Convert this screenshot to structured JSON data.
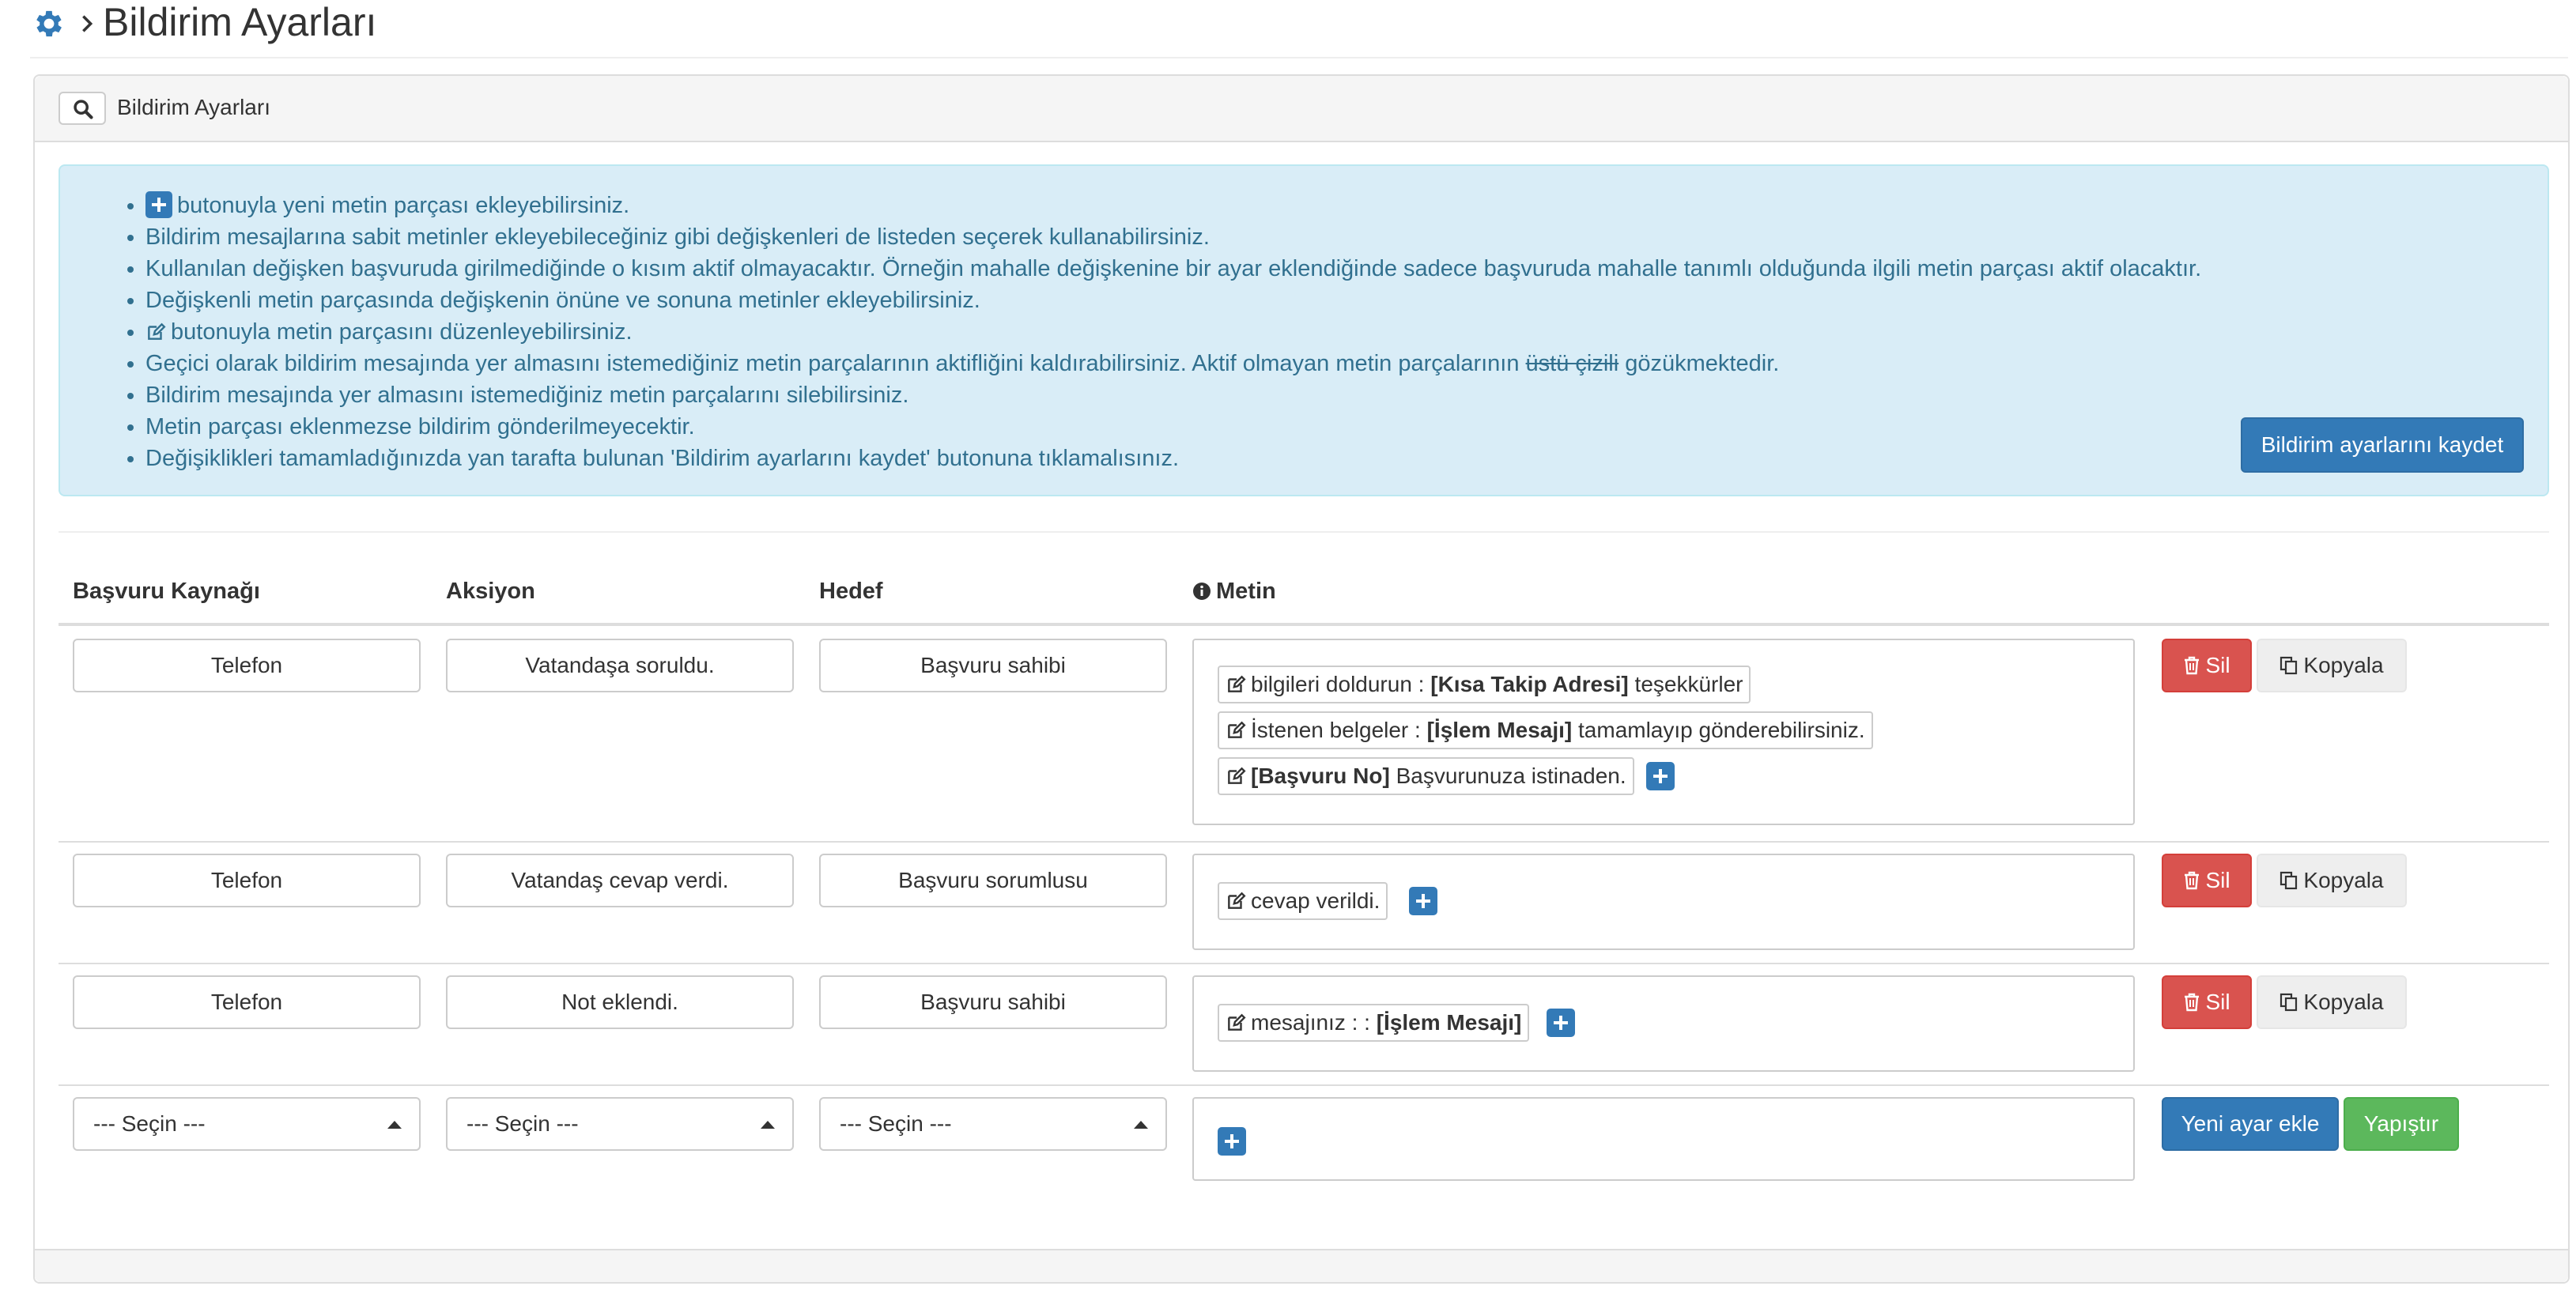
{
  "header": {
    "title": "Bildirim Ayarları"
  },
  "panel": {
    "title": "Bildirim Ayarları"
  },
  "info": {
    "items": [
      "butonuyla yeni metin parçası ekleyebilirsiniz.",
      "Bildirim mesajlarına sabit metinler ekleyebileceğiniz gibi değişkenleri de listeden seçerek kullanabilirsiniz.",
      "Kullanılan değişken başvuruda girilmediğinde o kısım aktif olmayacaktır. Örneğin mahalle değişkenine bir ayar eklendiğinde sadece başvuruda mahalle tanımlı olduğunda ilgili metin parçası aktif olacaktır.",
      "Değişkenli metin parçasında değişkenin önüne ve sonuna metinler ekleyebilirsiniz.",
      "butonuyla metin parçasını düzenleyebilirsiniz.",
      "Geçici olarak bildirim mesajında yer almasını istemediğiniz metin parçalarının aktifliğini kaldırabilirsiniz. Aktif olmayan metin parçalarının",
      "Bildirim mesajında yer almasını istemediğiniz metin parçalarını silebilirsiniz.",
      "Metin parçası eklenmezse bildirim gönderilmeyecektir.",
      "Değişiklikleri tamamladığınızda yan tarafta bulunan 'Bildirim ayarlarını kaydet' butonuna tıklamalısınız."
    ],
    "strike_text": "üstü çizili",
    "strike_suffix": "gözükmektedir.",
    "save_label": "Bildirim ayarlarını kaydet"
  },
  "table": {
    "headers": {
      "source": "Başvuru Kaynağı",
      "action": "Aksiyon",
      "target": "Hedef",
      "text": "Metin"
    },
    "rows": [
      {
        "source": "Telefon",
        "action": "Vatandaşa soruldu.",
        "target": "Başvuru sahibi",
        "chips": [
          {
            "pre": "bilgileri doldurun :",
            "var": "[Kısa Takip Adresi]",
            "post": "teşekkürler"
          },
          {
            "pre": "İstenen belgeler :",
            "var": "[İşlem Mesajı]",
            "post": "tamamlayıp gönderebilirsiniz."
          },
          {
            "pre": "",
            "var": "[Başvuru No]",
            "post": "Başvurunuza istinaden."
          }
        ]
      },
      {
        "source": "Telefon",
        "action": "Vatandaş cevap verdi.",
        "target": "Başvuru sorumlusu",
        "chips": [
          {
            "pre": "cevap verildi.",
            "var": "",
            "post": ""
          }
        ]
      },
      {
        "source": "Telefon",
        "action": "Not eklendi.",
        "target": "Başvuru sahibi",
        "chips": [
          {
            "pre": "mesajınız : :",
            "var": "[İşlem Mesajı]",
            "post": ""
          }
        ]
      }
    ],
    "delete_label": "Sil",
    "copy_label": "Kopyala",
    "new_row": {
      "select_placeholder": "--- Seçin ---",
      "add_label": "Yeni ayar ekle",
      "paste_label": "Yapıştır"
    }
  },
  "colors": {
    "primary": "#337ab7",
    "danger": "#d9534f",
    "success": "#5cb85c",
    "info_bg": "#d9edf7",
    "info_text": "#31708f"
  },
  "icons": [
    "gear-icon",
    "chevron-right-icon",
    "search-icon",
    "plus-icon",
    "edit-icon",
    "info-circle-icon",
    "trash-icon",
    "copy-icon",
    "caret-up-icon"
  ]
}
